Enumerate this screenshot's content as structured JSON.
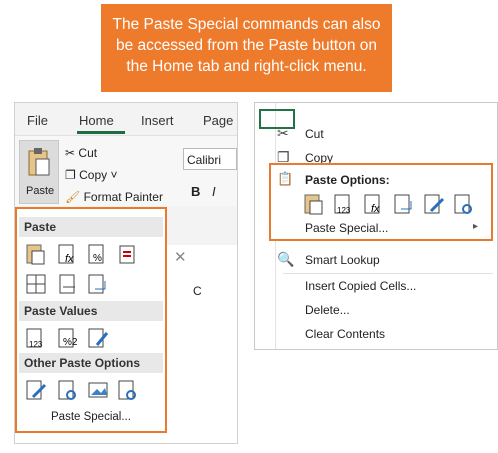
{
  "callout": {
    "line1": "The Paste Special commands can also",
    "line2": "be accessed from the Paste button on",
    "line3": "the Home tab and right-click menu."
  },
  "ribbon": {
    "tabs": [
      "File",
      "Home",
      "Insert",
      "Page"
    ],
    "paste_label": "Paste",
    "cut_label": "Cut",
    "copy_label": "Copy",
    "format_painter_label": "Format Painter",
    "font_name": "Calibri",
    "bold": "B",
    "italic": "I",
    "column_c": "C"
  },
  "paste_dropdown": {
    "section_paste": "Paste",
    "section_values": "Paste Values",
    "section_other": "Other Paste Options",
    "paste_special": "Paste Special..."
  },
  "context_menu": {
    "cut": "Cut",
    "copy": "Copy",
    "paste_options_header": "Paste Options:",
    "paste_special": "Paste Special...",
    "smart_lookup": "Smart Lookup",
    "insert_copied": "Insert Copied Cells...",
    "delete": "Delete...",
    "clear_contents": "Clear Contents"
  },
  "colors": {
    "accent": "#ee7b2c",
    "highlight_border": "#e87b2e",
    "excel_green": "#217346"
  }
}
